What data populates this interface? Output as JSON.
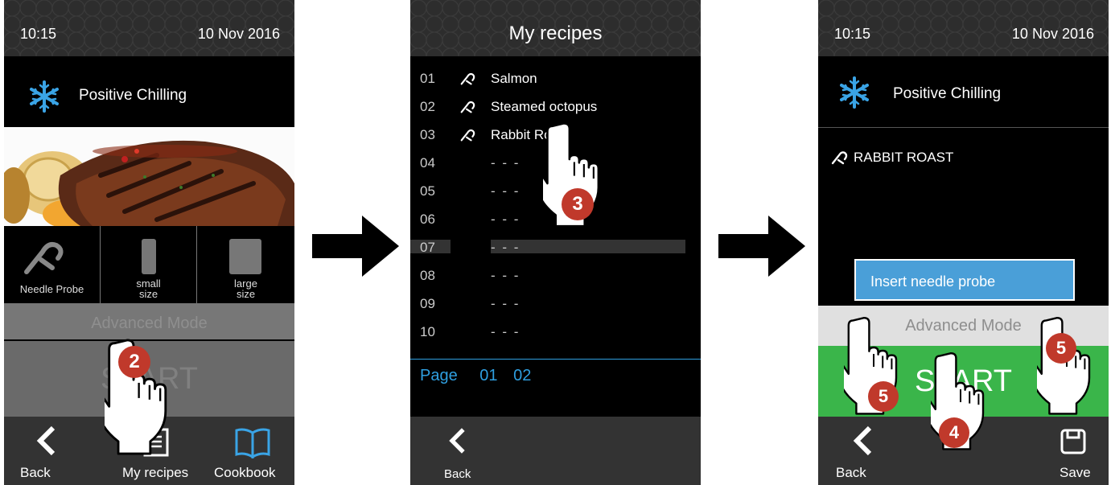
{
  "screen1": {
    "time": "10:15",
    "date": "10 Nov 2016",
    "mode": "Positive Chilling",
    "probe_options": [
      {
        "label": "Needle Probe",
        "icon": "needle-probe-icon"
      },
      {
        "label_line1": "small",
        "label_line2": "size",
        "icon": "small-size-icon"
      },
      {
        "label_line1": "large",
        "label_line2": "size",
        "icon": "large-size-icon"
      }
    ],
    "advanced_mode": "Advanced Mode",
    "start": "START",
    "bottom": {
      "back": "Back",
      "my_recipes": "My recipes",
      "cookbook": "Cookbook"
    },
    "step_badge": "2"
  },
  "screen2": {
    "title": "My recipes",
    "recipes": [
      {
        "num": "01",
        "name": "Salmon",
        "has_icon": true
      },
      {
        "num": "02",
        "name": "Steamed octopus",
        "has_icon": true
      },
      {
        "num": "03",
        "name": "Rabbit Roast",
        "has_icon": true
      },
      {
        "num": "04",
        "name": "- - -",
        "has_icon": false
      },
      {
        "num": "05",
        "name": "- - -",
        "has_icon": false
      },
      {
        "num": "06",
        "name": "- - -",
        "has_icon": false
      },
      {
        "num": "07",
        "name": "- - -",
        "has_icon": false
      },
      {
        "num": "08",
        "name": "- - -",
        "has_icon": false
      },
      {
        "num": "09",
        "name": "- - -",
        "has_icon": false
      },
      {
        "num": "10",
        "name": "- - -",
        "has_icon": false
      }
    ],
    "page_label": "Page",
    "pages": [
      "01",
      "02"
    ],
    "back": "Back",
    "step_badge": "3"
  },
  "screen3": {
    "time": "10:15",
    "date": "10 Nov 2016",
    "mode": "Positive Chilling",
    "recipe": "RABBIT ROAST",
    "popup": "Insert needle probe",
    "advanced_mode": "Advanced Mode",
    "start": "START",
    "bottom": {
      "back": "Back",
      "save": "Save"
    },
    "step_badges": [
      "4",
      "5",
      "5"
    ]
  },
  "colors": {
    "badge": "#c0392b",
    "start_green": "#3ab54a",
    "popup_blue": "#4a9fd8",
    "page_blue": "#2f9fe0",
    "cookbook_blue": "#3aa4e6"
  }
}
